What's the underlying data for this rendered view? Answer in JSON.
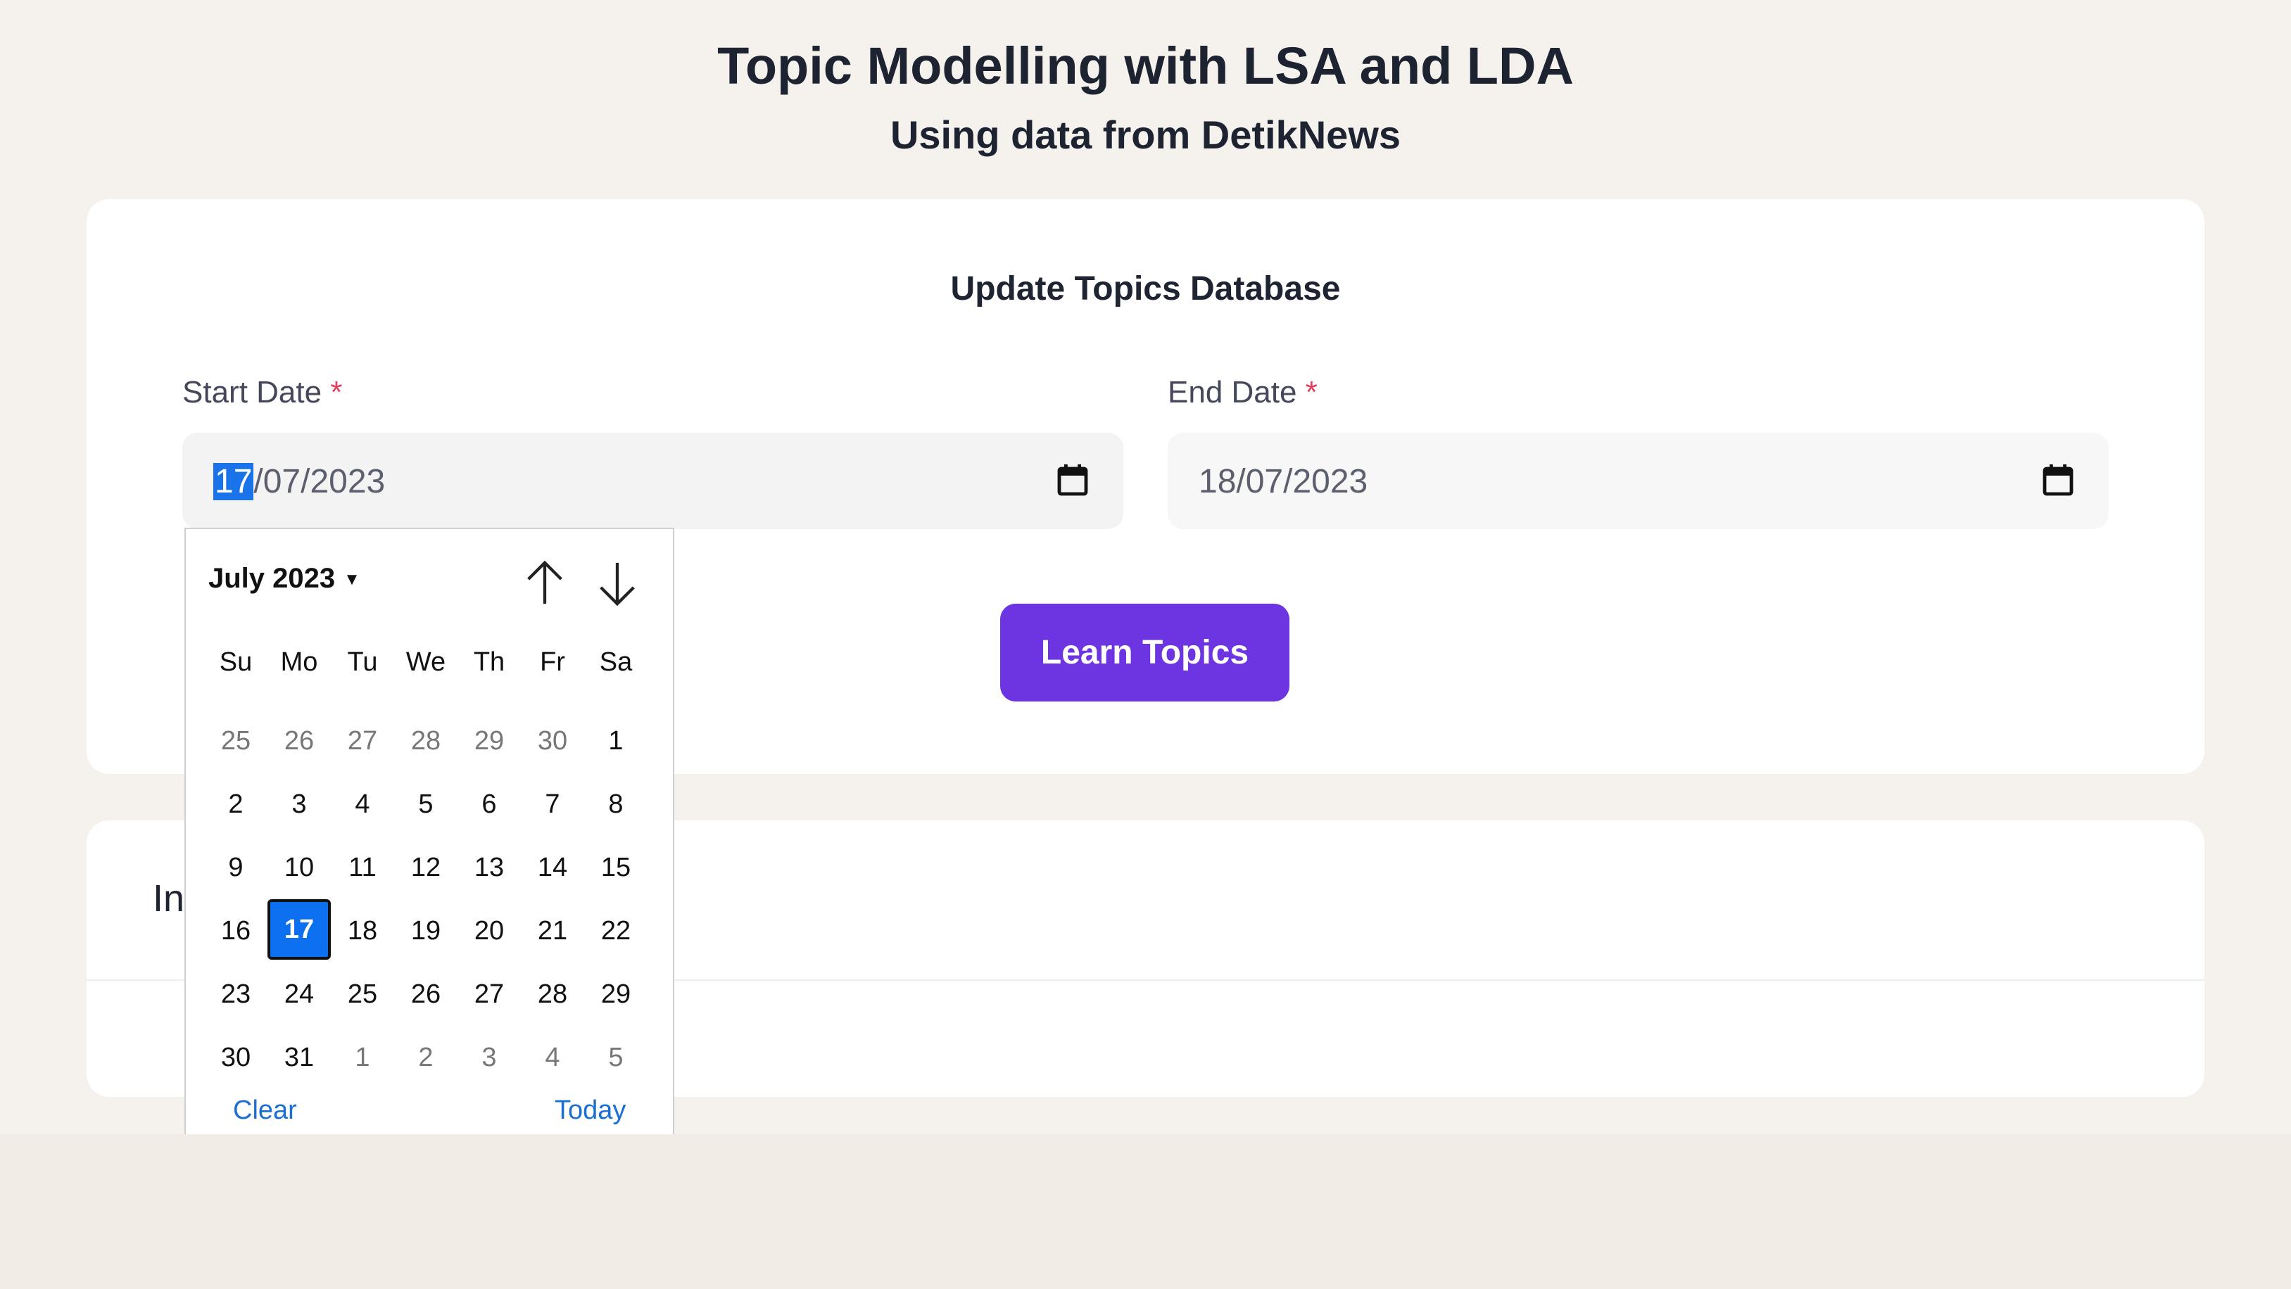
{
  "header": {
    "title": "Topic Modelling with LSA and LDA",
    "subtitle": "Using data from DetikNews"
  },
  "update_card": {
    "title": "Update Topics Database",
    "start_date_label": "Start Date",
    "end_date_label": "End Date",
    "required_marker": "*",
    "start_date_day": "17",
    "start_date_rest": "/07/2023",
    "end_date_value": "18/07/2023",
    "learn_button": "Learn Topics"
  },
  "second_card": {
    "label_partial": "In"
  },
  "datepicker": {
    "month_year": "July 2023",
    "weekdays": [
      "Su",
      "Mo",
      "Tu",
      "We",
      "Th",
      "Fr",
      "Sa"
    ],
    "weeks": [
      [
        "25",
        "26",
        "27",
        "28",
        "29",
        "30",
        "1"
      ],
      [
        "2",
        "3",
        "4",
        "5",
        "6",
        "7",
        "8"
      ],
      [
        "9",
        "10",
        "11",
        "12",
        "13",
        "14",
        "15"
      ],
      [
        "16",
        "17",
        "18",
        "19",
        "20",
        "21",
        "22"
      ],
      [
        "23",
        "24",
        "25",
        "26",
        "27",
        "28",
        "29"
      ],
      [
        "30",
        "31",
        "1",
        "2",
        "3",
        "4",
        "5"
      ]
    ],
    "selected_day": "17",
    "clear_label": "Clear",
    "today_label": "Today"
  },
  "colors": {
    "accent_button": "#6d35e1",
    "selected_day": "#0b6ff0",
    "link": "#1a6fd1",
    "required": "#e53e5a"
  },
  "icons": [
    "calendar-icon",
    "arrow-up-icon",
    "arrow-down-icon",
    "caret-down-icon"
  ]
}
